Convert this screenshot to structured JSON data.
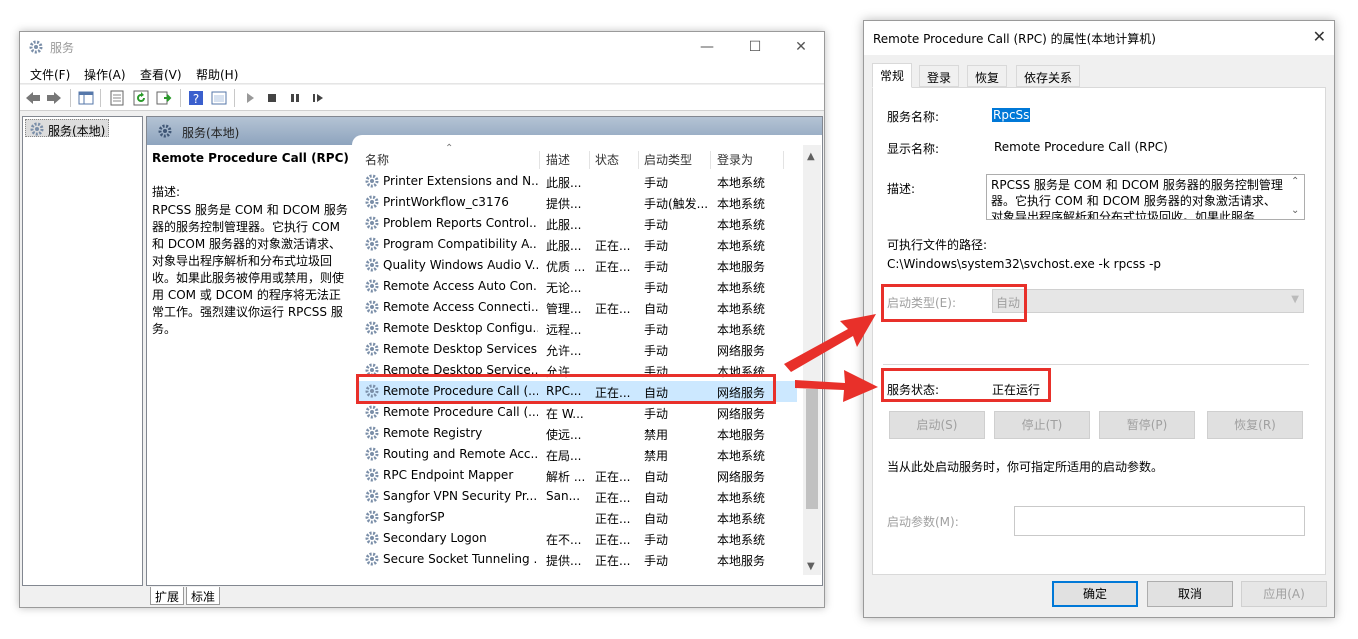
{
  "services_window": {
    "title": "服务",
    "menu": [
      "文件(F)",
      "操作(A)",
      "查看(V)",
      "帮助(H)"
    ],
    "tree_item": "服务(本地)",
    "main_header": "服务(本地)",
    "selected_service": {
      "name": "Remote Procedure Call (RPC)",
      "desc_label": "描述:",
      "description": "RPCSS 服务是 COM 和 DCOM 服务器的服务控制管理器。它执行 COM 和 DCOM 服务器的对象激活请求、对象导出程序解析和分布式垃圾回收。如果此服务被停用或禁用，则使用 COM 或 DCOM 的程序将无法正常工作。强烈建议你运行 RPCSS 服务。"
    },
    "columns": [
      "名称",
      "描述",
      "状态",
      "启动类型",
      "登录为"
    ],
    "rows": [
      {
        "name": "Printer Extensions and N...",
        "desc": "此服...",
        "status": "",
        "start": "手动",
        "logon": "本地系统"
      },
      {
        "name": "PrintWorkflow_c3176",
        "desc": "提供...",
        "status": "",
        "start": "手动(触发...",
        "logon": "本地系统"
      },
      {
        "name": "Problem Reports Control...",
        "desc": "此服...",
        "status": "",
        "start": "手动",
        "logon": "本地系统"
      },
      {
        "name": "Program Compatibility A...",
        "desc": "此服...",
        "status": "正在...",
        "start": "手动",
        "logon": "本地系统"
      },
      {
        "name": "Quality Windows Audio V...",
        "desc": "优质 ...",
        "status": "正在...",
        "start": "手动",
        "logon": "本地服务"
      },
      {
        "name": "Remote Access Auto Con...",
        "desc": "无论...",
        "status": "",
        "start": "手动",
        "logon": "本地系统"
      },
      {
        "name": "Remote Access Connecti...",
        "desc": "管理...",
        "status": "正在...",
        "start": "自动",
        "logon": "本地系统"
      },
      {
        "name": "Remote Desktop Configu...",
        "desc": "远程...",
        "status": "",
        "start": "手动",
        "logon": "本地系统"
      },
      {
        "name": "Remote Desktop Services",
        "desc": "允许...",
        "status": "",
        "start": "手动",
        "logon": "网络服务"
      },
      {
        "name": "Remote Desktop Service...",
        "desc": "允许...",
        "status": "",
        "start": "手动",
        "logon": "本地系统"
      },
      {
        "name": "Remote Procedure Call (...",
        "desc": "RPC...",
        "status": "正在...",
        "start": "自动",
        "logon": "网络服务"
      },
      {
        "name": "Remote Procedure Call (...",
        "desc": "在 W...",
        "status": "",
        "start": "手动",
        "logon": "网络服务"
      },
      {
        "name": "Remote Registry",
        "desc": "使远...",
        "status": "",
        "start": "禁用",
        "logon": "本地服务"
      },
      {
        "name": "Routing and Remote Acc...",
        "desc": "在局...",
        "status": "",
        "start": "禁用",
        "logon": "本地系统"
      },
      {
        "name": "RPC Endpoint Mapper",
        "desc": "解析 ...",
        "status": "正在...",
        "start": "自动",
        "logon": "网络服务"
      },
      {
        "name": "Sangfor VPN Security Pr...",
        "desc": "San...",
        "status": "正在...",
        "start": "自动",
        "logon": "本地系统"
      },
      {
        "name": "SangforSP",
        "desc": "",
        "status": "正在...",
        "start": "自动",
        "logon": "本地系统"
      },
      {
        "name": "Secondary Logon",
        "desc": "在不...",
        "status": "正在...",
        "start": "手动",
        "logon": "本地系统"
      },
      {
        "name": "Secure Socket Tunneling ...",
        "desc": "提供...",
        "status": "正在...",
        "start": "手动",
        "logon": "本地服务"
      }
    ],
    "bottom_tabs": [
      "扩展",
      "标准"
    ]
  },
  "dialog": {
    "title": "Remote Procedure Call (RPC) 的属性(本地计算机)",
    "tabs": [
      "常规",
      "登录",
      "恢复",
      "依存关系"
    ],
    "service_name_label": "服务名称:",
    "service_name_value": "RpcSs",
    "display_name_label": "显示名称:",
    "display_name_value": "Remote Procedure Call (RPC)",
    "description_label": "描述:",
    "description_value": "RPCSS 服务是 COM 和 DCOM 服务器的服务控制管理器。它执行 COM 和 DCOM 服务器的对象激活请求、对象导出程序解析和分布式垃圾回收。如果此服务",
    "path_label": "可执行文件的路径:",
    "path_value": "C:\\Windows\\system32\\svchost.exe -k rpcss -p",
    "startup_type_label": "启动类型(E):",
    "startup_type_value": "自动",
    "status_label": "服务状态:",
    "status_value": "正在运行",
    "buttons": [
      "启动(S)",
      "停止(T)",
      "暂停(P)",
      "恢复(R)"
    ],
    "hint": "当从此处启动服务时，你可指定所适用的启动参数。",
    "param_label": "启动参数(M):",
    "footer_buttons": [
      "确定",
      "取消",
      "应用(A)"
    ]
  },
  "colors": {
    "highlight": "#e8302a",
    "selection": "#0078d7"
  }
}
